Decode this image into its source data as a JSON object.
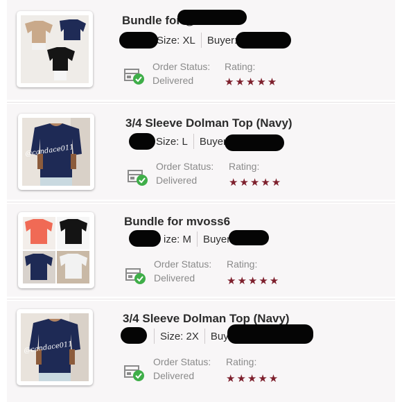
{
  "orders": [
    {
      "title": "Bundle for @",
      "size_label": "Size: XL",
      "buyer_label": "Buyer: u",
      "status_label": "Order Status:",
      "status_value": "Delivered",
      "rating_label": "Rating:",
      "rating": "★★★★★"
    },
    {
      "title": "3/4 Sleeve Dolman Top (Navy)",
      "size_label": "Size: L",
      "buyer_label": "Buyer",
      "status_label": "Order Status:",
      "status_value": "Delivered",
      "rating_label": "Rating:",
      "rating": "★★★★★",
      "thumb_watermark": "@candace011"
    },
    {
      "title": "Bundle for mvoss6",
      "size_label": "ize: M",
      "buyer_label": "Buyer",
      "status_label": "Order Status:",
      "status_value": "Delivered",
      "rating_label": "Rating:",
      "rating": "★★★★★"
    },
    {
      "title": "3/4 Sleeve Dolman Top (Navy)",
      "size_label": "Size: 2X",
      "buyer_label": "Buyer",
      "status_label": "Order Status:",
      "status_value": "Delivered",
      "rating_label": "Rating:",
      "rating": "★★★★★",
      "thumb_watermark": "@candace011"
    }
  ],
  "colors": {
    "card_bg": "#f8f6f7",
    "star": "#7d1f2c",
    "check": "#3fae49",
    "label": "#8a8a8a"
  }
}
